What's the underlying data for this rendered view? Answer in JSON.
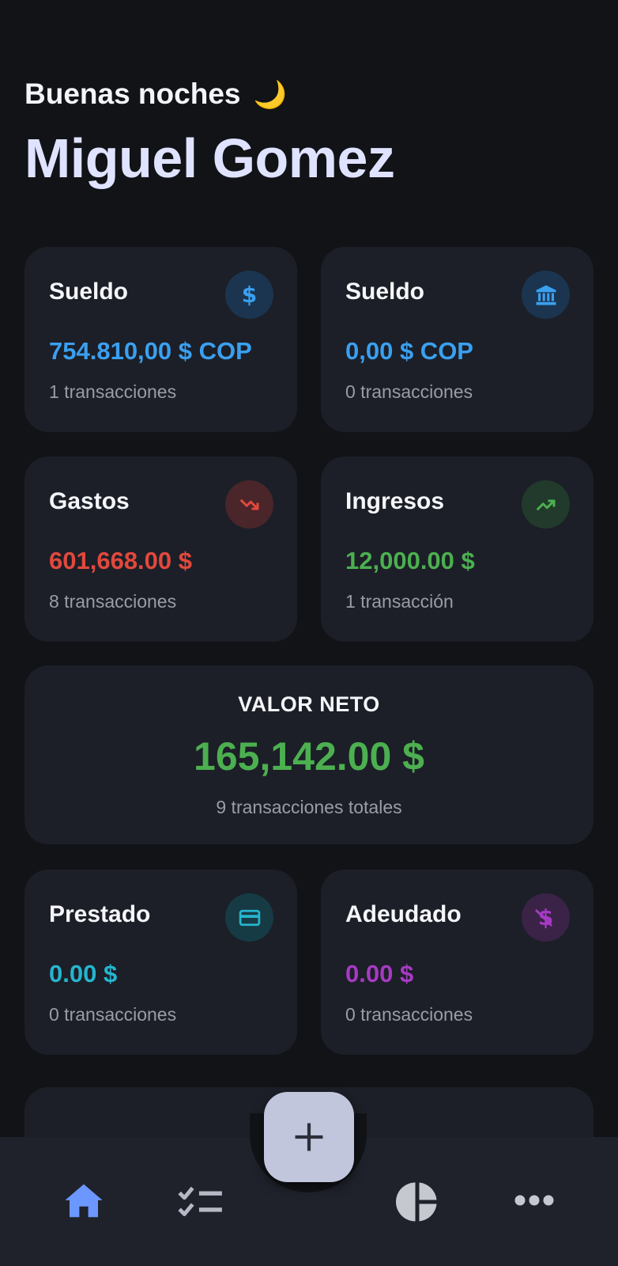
{
  "greeting": {
    "text": "Buenas noches",
    "emoji": "🌙"
  },
  "user": {
    "name": "Miguel Gomez"
  },
  "cards": [
    {
      "title": "Sueldo",
      "amount": "754.810,00 $ COP",
      "count": "1 transacciones",
      "icon": "dollar-icon",
      "color": "#3aa0f0"
    },
    {
      "title": "Sueldo",
      "amount": "0,00 $ COP",
      "count": "0 transacciones",
      "icon": "bank-icon",
      "color": "#3aa0f0"
    },
    {
      "title": "Gastos",
      "amount": "601,668.00 $",
      "count": "8 transacciones",
      "icon": "trending-down-icon",
      "color": "#e2483d"
    },
    {
      "title": "Ingresos",
      "amount": "12,000.00 $",
      "count": "1 transacción",
      "icon": "trending-up-icon",
      "color": "#4caf50"
    },
    {
      "title": "Prestado",
      "amount": "0.00 $",
      "count": "0 transacciones",
      "icon": "credit-card-icon",
      "color": "#26b5cf"
    },
    {
      "title": "Adeudado",
      "amount": "0.00 $",
      "count": "0 transacciones",
      "icon": "money-off-icon",
      "color": "#a73ac4"
    }
  ],
  "net_worth": {
    "label": "VALOR NETO",
    "value": "165,142.00 $",
    "total": "9 transacciones totales",
    "color": "#4caf50"
  },
  "nav": {
    "items": [
      "home-icon",
      "checklist-icon",
      "pie-chart-icon",
      "more-icon"
    ],
    "active": "home-icon",
    "fab": "plus-icon"
  }
}
